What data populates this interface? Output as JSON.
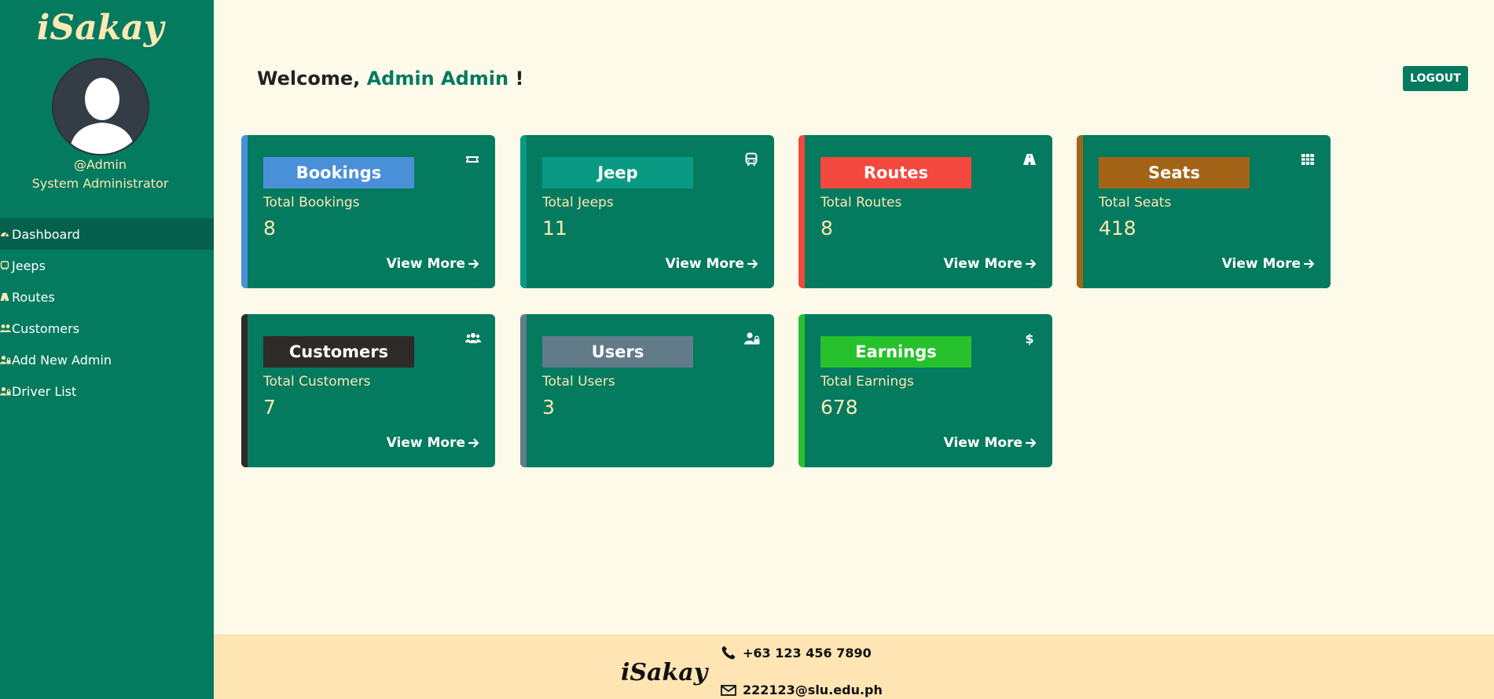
{
  "app": {
    "brand": "iSakay"
  },
  "sidebar": {
    "handle": "@Admin",
    "role": "System Administrator",
    "items": [
      {
        "label": "Dashboard",
        "icon": "gauge-icon",
        "active": true
      },
      {
        "label": "Jeeps",
        "icon": "bus-icon",
        "active": false
      },
      {
        "label": "Routes",
        "icon": "road-icon",
        "active": false
      },
      {
        "label": "Customers",
        "icon": "users-icon",
        "active": false
      },
      {
        "label": "Add New Admin",
        "icon": "user-lock-icon",
        "active": false
      },
      {
        "label": "Driver List",
        "icon": "user-lock-icon",
        "active": false
      }
    ]
  },
  "header": {
    "welcome_prefix": "Welcome,",
    "user_name": "Admin Admin",
    "welcome_suffix": "!",
    "logout_label": "LOGOUT"
  },
  "cards": [
    {
      "title": "Bookings",
      "subtitle": "Total Bookings",
      "value": "8",
      "more": "View More",
      "label_color": "#4a90d9",
      "stripe_color": "#4a90d9",
      "icon": "ticket-icon"
    },
    {
      "title": "Jeep",
      "subtitle": "Total Jeeps",
      "value": "11",
      "more": "View More",
      "label_color": "#0a9a84",
      "stripe_color": "#0a9a84",
      "icon": "bus-icon"
    },
    {
      "title": "Routes",
      "subtitle": "Total Routes",
      "value": "8",
      "more": "View More",
      "label_color": "#f2483d",
      "stripe_color": "#f2483d",
      "icon": "road-icon"
    },
    {
      "title": "Seats",
      "subtitle": "Total Seats",
      "value": "418",
      "more": "View More",
      "label_color": "#a36418",
      "stripe_color": "#a36418",
      "icon": "grid-icon"
    },
    {
      "title": "Customers",
      "subtitle": "Total Customers",
      "value": "7",
      "more": "View More",
      "label_color": "#2e2a27",
      "stripe_color": "#2e2a27",
      "icon": "users-icon"
    },
    {
      "title": "Users",
      "subtitle": "Total Users",
      "value": "3",
      "more": "",
      "label_color": "#617b89",
      "stripe_color": "#617b89",
      "icon": "user-lock-icon"
    },
    {
      "title": "Earnings",
      "subtitle": "Total Earnings",
      "value": "678",
      "more": "View More",
      "label_color": "#27c12d",
      "stripe_color": "#27c12d",
      "icon": "dollar-icon"
    }
  ],
  "footer": {
    "brand": "iSakay",
    "phone": "+63 123 456 7890",
    "email": "222123@slu.edu.ph"
  }
}
